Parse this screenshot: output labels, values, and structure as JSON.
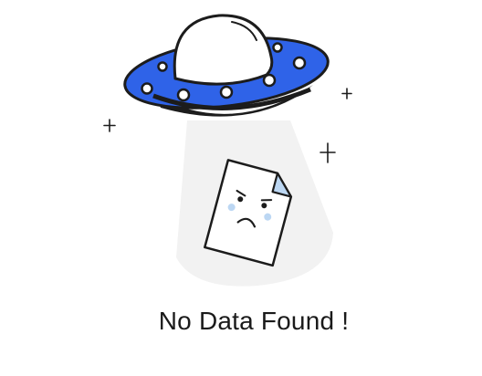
{
  "empty_state": {
    "message": "No Data Found !",
    "illustration_icon": "ufo-abducting-document-icon"
  },
  "colors": {
    "ufo_body": "#2f63e8",
    "ufo_dome": "#ffffff",
    "outline": "#1c1c1c",
    "beam": "#f2f2f2",
    "document_fold": "#bcd7f3",
    "cheeks": "#bcd7f3",
    "text": "#1a1a1a"
  }
}
